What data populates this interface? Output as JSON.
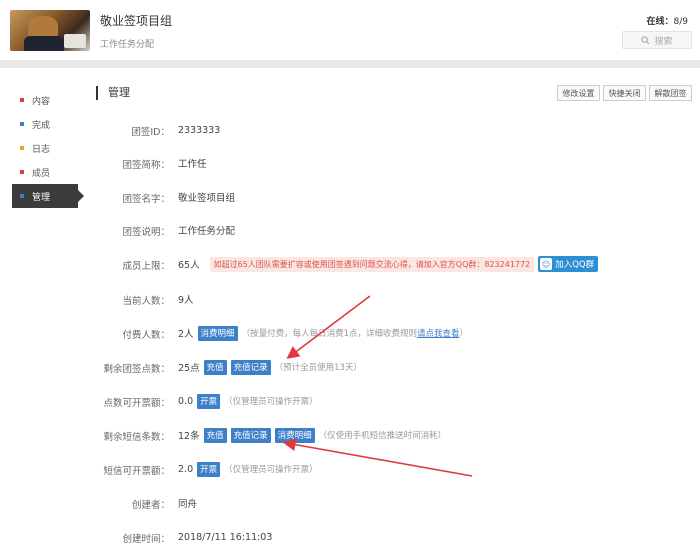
{
  "header": {
    "title": "敬业签项目组",
    "subtitle": "工作任务分配",
    "online_label": "在线：",
    "online_count": "8/9",
    "search_placeholder": "搜索"
  },
  "sidebar": {
    "items": [
      {
        "label": "内容",
        "color": "#e0393e"
      },
      {
        "label": "完成",
        "color": "#3d7fc8"
      },
      {
        "label": "日志",
        "color": "#f0a030"
      },
      {
        "label": "成员",
        "color": "#e0393e"
      },
      {
        "label": "管理",
        "color": "#3d7fc8",
        "active": true
      }
    ]
  },
  "main": {
    "title": "管理",
    "toolbar": [
      "修改设置",
      "快捷关闭",
      "解散团签"
    ],
    "rows": {
      "team_id": {
        "label": "团签ID：",
        "value": "2333333"
      },
      "short_name": {
        "label": "团签简称：",
        "value": "工作任"
      },
      "name": {
        "label": "团签名字：",
        "value": "敬业签项目组"
      },
      "description": {
        "label": "团签说明：",
        "value": "工作任务分配"
      },
      "member_limit": {
        "label": "成员上限：",
        "value": "65人",
        "warning": "如超过65人团队需要扩容或使用团签遇到问题交流心得，请加入官方QQ群：823241772",
        "qq_button": "加入QQ群"
      },
      "current_count": {
        "label": "当前人数：",
        "value": "9人"
      },
      "paid_count": {
        "label": "付费人数：",
        "value": "2人",
        "button": "消费明细",
        "note": "（按量付费，每人每日消费1点，详细收费规则",
        "note_link": "请点我查看",
        "note_end": "）"
      },
      "points_left": {
        "label": "剩余团签点数：",
        "value": "25点",
        "button1": "充值",
        "button2": "充值记录",
        "note": "（预计全员使用13天）"
      },
      "points_invoice": {
        "label": "点数可开票额：",
        "value": "0.0",
        "button": "开票",
        "note": "（仅管理员可操作开票）"
      },
      "sms_left": {
        "label": "剩余短信条数：",
        "value": "12条",
        "button1": "充值",
        "button2": "充值记录",
        "button3": "消费明细",
        "note": "（仅使用手机短信推送时间消耗）"
      },
      "sms_invoice": {
        "label": "短信可开票额：",
        "value": "2.0",
        "button": "开票",
        "note": "（仅管理员可操作开票）"
      },
      "creator": {
        "label": "创建者：",
        "value": "同舟"
      },
      "created_at": {
        "label": "创建时间：",
        "value": "2018/7/11 16:11:03"
      }
    }
  }
}
